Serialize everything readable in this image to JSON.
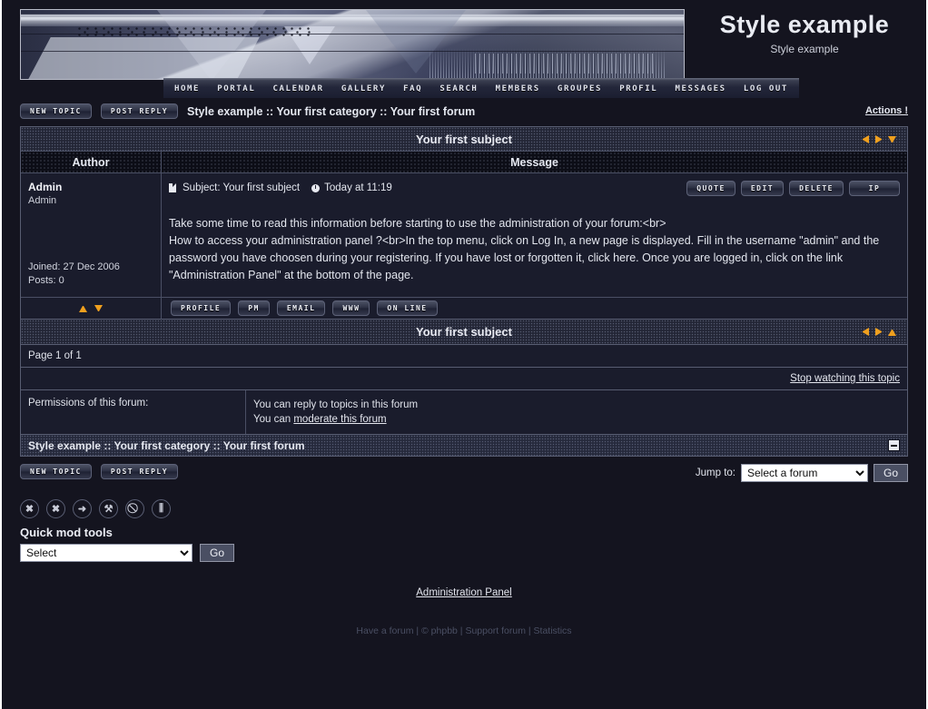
{
  "site": {
    "title": "Style example",
    "subtitle": "Style example"
  },
  "nav": {
    "items": [
      {
        "label": "HOME",
        "name": "nav-home"
      },
      {
        "label": "PORTAL",
        "name": "nav-portal"
      },
      {
        "label": "CALENDAR",
        "name": "nav-calendar"
      },
      {
        "label": "GALLERY",
        "name": "nav-gallery"
      },
      {
        "label": "FAQ",
        "name": "nav-faq"
      },
      {
        "label": "SEARCH",
        "name": "nav-search"
      },
      {
        "label": "MEMBERS",
        "name": "nav-members"
      },
      {
        "label": "GROUPES",
        "name": "nav-groupes"
      },
      {
        "label": "PROFIL",
        "name": "nav-profil"
      },
      {
        "label": "MESSAGES",
        "name": "nav-messages"
      },
      {
        "label": "LOG OUT",
        "name": "nav-logout"
      }
    ]
  },
  "toolbar": {
    "new_topic": "NEW TOPIC",
    "post_reply": "POST REPLY",
    "breadcrumb": "Style example :: Your first category :: Your first forum",
    "actions": "Actions !"
  },
  "topic": {
    "title": "Your first subject",
    "columns": {
      "author": "Author",
      "message": "Message"
    }
  },
  "post": {
    "author_name": "Admin",
    "author_rank": "Admin",
    "joined": "Joined: 27 Dec 2006",
    "posts": "Posts: 0",
    "subject": "Subject: Your first subject",
    "time": "Today at 11:19",
    "actions": [
      {
        "label": "QUOTE",
        "name": "quote-button"
      },
      {
        "label": "EDIT",
        "name": "edit-button"
      },
      {
        "label": "DELETE",
        "name": "delete-button"
      },
      {
        "label": "IP",
        "name": "ip-button"
      }
    ],
    "body_line1": "Take some time to read this information before starting to use the administration of your forum:<br>",
    "body_line2": "How to access your administration panel ?<br>In the top menu, click on Log In, a new page is displayed. Fill in the username \"admin\" and the password you have choosen during your registering. If you have lost or forgotten it, click here. Once you are logged in, click on the link \"Administration Panel\" at the bottom of the page.",
    "user_buttons": [
      {
        "label": "PROFILE",
        "name": "profile-button"
      },
      {
        "label": "PM",
        "name": "pm-button"
      },
      {
        "label": "EMAIL",
        "name": "email-button"
      },
      {
        "label": "WWW",
        "name": "www-button"
      },
      {
        "label": "ON LINE",
        "name": "online-button"
      }
    ]
  },
  "footer_panel": {
    "topic_title_bottom": "Your first subject",
    "page_info": "Page 1 of 1",
    "watch_link": "Stop watching this topic",
    "permissions_label": "Permissions of this forum:",
    "permission_1": "You can reply to topics in this forum",
    "permission_2_prefix": "You can ",
    "permission_2_link": "moderate this forum",
    "breadcrumb_bottom": "Style example :: Your first category :: Your first forum"
  },
  "jump": {
    "label": "Jump to:",
    "selected": "Select a forum",
    "go": "Go"
  },
  "quickmod": {
    "label": "Quick mod tools",
    "selected": "Select",
    "go": "Go",
    "icons": [
      {
        "name": "delete-icon",
        "glyph": "✖"
      },
      {
        "name": "delete-alt-icon",
        "glyph": "✖"
      },
      {
        "name": "move-right-icon",
        "glyph": "➜"
      },
      {
        "name": "wrench-icon",
        "glyph": "⚒"
      },
      {
        "name": "lock-icon",
        "glyph": "⃠"
      },
      {
        "name": "split-icon",
        "glyph": "⫼"
      }
    ]
  },
  "bottom": {
    "admin_panel": "Administration Panel",
    "credits": [
      {
        "label": "Have a forum",
        "name": "footer-link-have-a-forum"
      },
      {
        "label": "© phpbb",
        "name": "footer-link-phpbb"
      },
      {
        "label": "Support forum",
        "name": "footer-link-support"
      },
      {
        "label": "Statistics",
        "name": "footer-link-statistics"
      }
    ],
    "separator": "|"
  },
  "colors": {
    "page_bg": "#14141f",
    "panel_bg": "#1a1c2c",
    "accent_arrow": "#f0a01e",
    "text": "#e3e6ee",
    "border": "#585d72"
  }
}
